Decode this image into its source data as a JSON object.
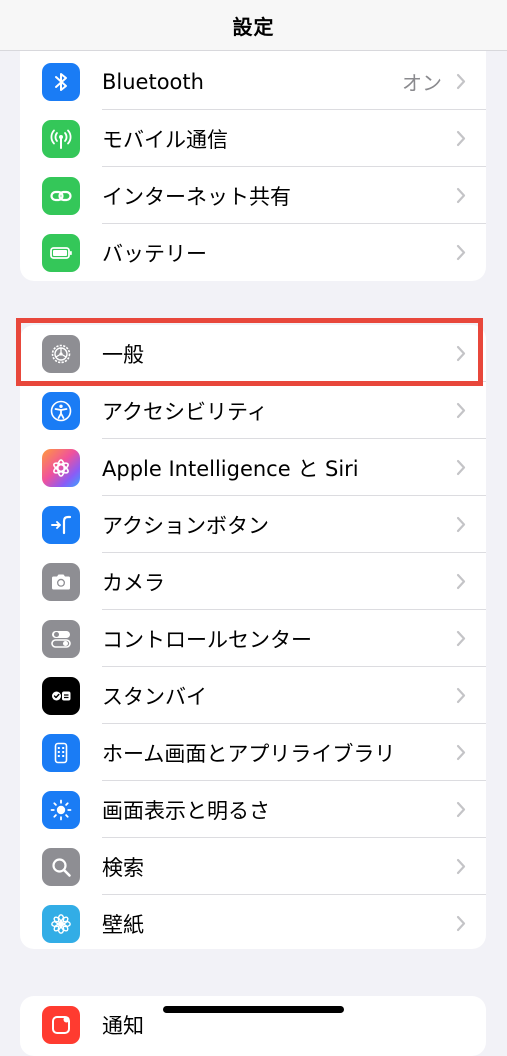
{
  "navbar": {
    "title": "設定"
  },
  "colors": {
    "highlight": "#e8473b",
    "background": "#f2f2f7"
  },
  "group1": [
    {
      "label": "Bluetooth",
      "value": "オン",
      "icon": "bluetooth-icon",
      "color": "#1a7cf5"
    },
    {
      "label": "モバイル通信",
      "icon": "antenna-icon",
      "color": "#34c759"
    },
    {
      "label": "インターネット共有",
      "icon": "chain-link-icon",
      "color": "#34c759"
    },
    {
      "label": "バッテリー",
      "icon": "battery-icon",
      "color": "#34c759"
    }
  ],
  "group2": [
    {
      "label": "一般",
      "icon": "gear-icon",
      "color": "#8e8e93",
      "highlighted": true
    },
    {
      "label": "アクセシビリティ",
      "icon": "accessibility-icon",
      "color": "#1a7cf5"
    },
    {
      "label": "Apple Intelligence と Siri",
      "icon": "apple-intelligence-icon",
      "color": "gradient"
    },
    {
      "label": "アクションボタン",
      "icon": "action-button-icon",
      "color": "#1a7cf5"
    },
    {
      "label": "カメラ",
      "icon": "camera-icon",
      "color": "#8e8e93"
    },
    {
      "label": "コントロールセンター",
      "icon": "toggles-icon",
      "color": "#8e8e93"
    },
    {
      "label": "スタンバイ",
      "icon": "standby-icon",
      "color": "#000000"
    },
    {
      "label": "ホーム画面とアプリライブラリ",
      "icon": "phone-grid-icon",
      "color": "#1a7cf5"
    },
    {
      "label": "画面表示と明るさ",
      "icon": "sun-icon",
      "color": "#1a7cf5"
    },
    {
      "label": "検索",
      "icon": "magnifier-icon",
      "color": "#8e8e93"
    },
    {
      "label": "壁紙",
      "icon": "flower-icon",
      "color": "#32ade6"
    }
  ],
  "group3": [
    {
      "label": "通知",
      "icon": "notification-icon",
      "color": "#ff3b30"
    }
  ]
}
